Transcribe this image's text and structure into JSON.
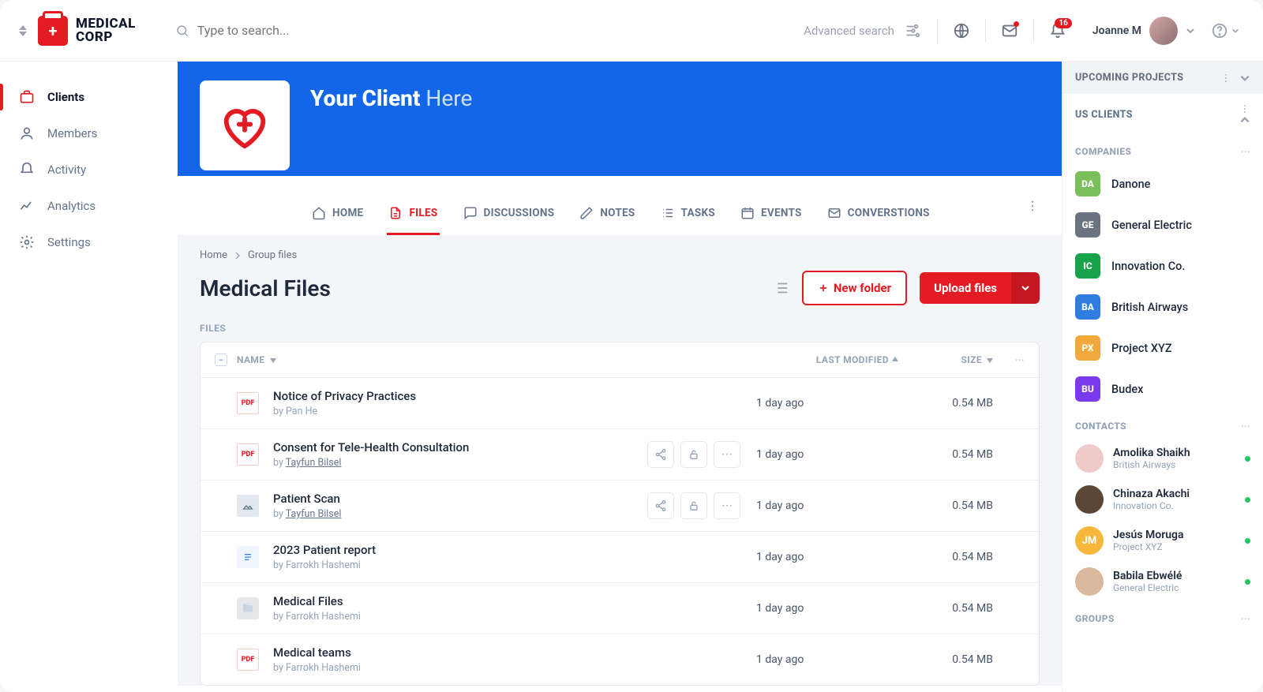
{
  "brand": {
    "line1": "MEDICAL",
    "line2": "CORP"
  },
  "search": {
    "placeholder": "Type to search...",
    "advanced": "Advanced search"
  },
  "notifications": {
    "count": "16"
  },
  "user": {
    "name": "Joanne M"
  },
  "nav": [
    {
      "label": "Clients"
    },
    {
      "label": "Members"
    },
    {
      "label": "Activity"
    },
    {
      "label": "Analytics"
    },
    {
      "label": "Settings"
    }
  ],
  "client": {
    "title_bold": "Your Client",
    "title_rest": " Here"
  },
  "tabs": [
    {
      "label": "HOME"
    },
    {
      "label": "FILES"
    },
    {
      "label": "DISCUSSIONS"
    },
    {
      "label": "NOTES"
    },
    {
      "label": "TASKS"
    },
    {
      "label": "EVENTS"
    },
    {
      "label": "CONVERSTIONS"
    }
  ],
  "breadcrumb": {
    "root": "Home",
    "current": "Group files"
  },
  "page_title": "Medical Files",
  "buttons": {
    "new_folder": "New folder",
    "upload": "Upload files"
  },
  "files_label": "FILES",
  "columns": {
    "name": "NAME",
    "modified": "LAST MODIFIED",
    "size": "SIZE"
  },
  "by_prefix": "by ",
  "files": [
    {
      "name": "Notice of Privacy Practices",
      "author": "Pan He",
      "author_link": false,
      "type": "pdf",
      "modified": "1 day ago",
      "size": "0.54 MB",
      "actions": false
    },
    {
      "name": "Consent for Tele-Health Consultation",
      "author": "Tayfun Bilsel",
      "author_link": true,
      "type": "pdf",
      "modified": "1 day ago",
      "size": "0.54 MB",
      "actions": true
    },
    {
      "name": "Patient Scan",
      "author": "Tayfun Bilsel",
      "author_link": true,
      "type": "img",
      "modified": "1 day ago",
      "size": "0.54 MB",
      "actions": true
    },
    {
      "name": "2023 Patient report",
      "author": "Farrokh Hashemi",
      "author_link": false,
      "type": "doc",
      "modified": "1 day ago",
      "size": "0.54 MB",
      "actions": false
    },
    {
      "name": "Medical Files",
      "author": "Farrokh Hashemi",
      "author_link": false,
      "type": "folder",
      "modified": "1 day ago",
      "size": "0.54 MB",
      "actions": false
    },
    {
      "name": "Medical teams",
      "author": "Farrokh Hashemi",
      "author_link": false,
      "type": "pdf",
      "modified": "1 day ago",
      "size": "0.54 MB",
      "actions": false
    }
  ],
  "right": {
    "upcoming": "UPCOMING PROJECTS",
    "us_clients": "US CLIENTS",
    "companies_label": "COMPANIES",
    "contacts_label": "CONTACTS",
    "groups_label": "GROUPS",
    "companies": [
      {
        "code": "DA",
        "name": "Danone",
        "color": "#7bbf5a"
      },
      {
        "code": "GE",
        "name": "General Electric",
        "color": "#6b7280"
      },
      {
        "code": "IC",
        "name": "Innovation Co.",
        "color": "#16a34a"
      },
      {
        "code": "BA",
        "name": "British Airways",
        "color": "#2f7de1"
      },
      {
        "code": "PX",
        "name": "Project XYZ",
        "color": "#f2a93b"
      },
      {
        "code": "BU",
        "name": "Budex",
        "color": "#7c3aed"
      }
    ],
    "contacts": [
      {
        "name": "Amolika Shaikh",
        "sub": "British Airways",
        "color": "#f0c9c9"
      },
      {
        "name": "Chinaza Akachi",
        "sub": "Innovation Co.",
        "color": "#5b4636"
      },
      {
        "name": "Jesús Moruga",
        "sub": "Project XYZ",
        "color": "#f6b73c",
        "initials": "JM"
      },
      {
        "name": "Babila Ebwélé",
        "sub": "General Electric",
        "color": "#d9b89b"
      }
    ]
  }
}
